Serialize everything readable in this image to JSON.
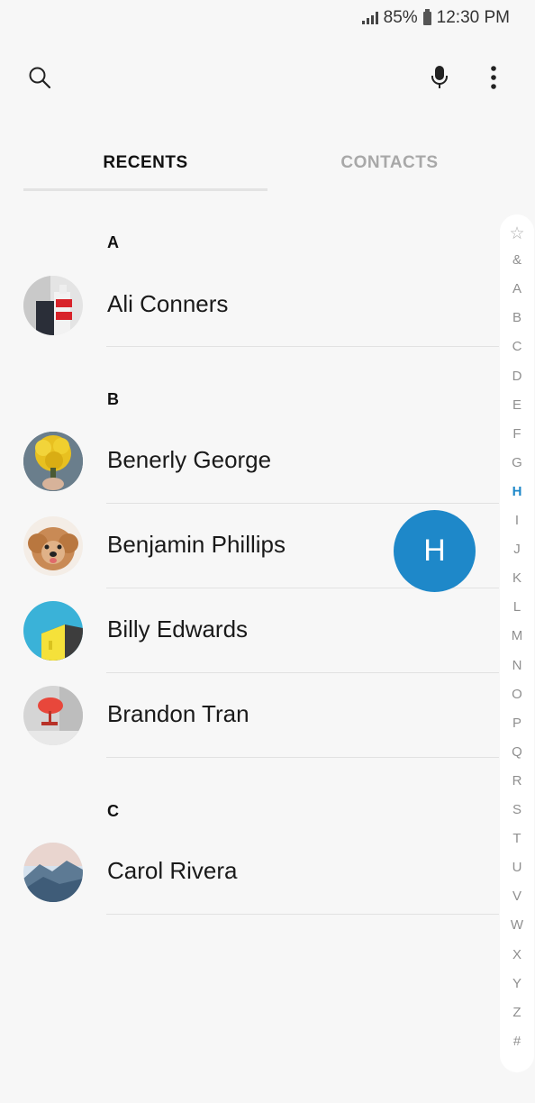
{
  "status_bar": {
    "battery_percent": "85%",
    "time": "12:30 PM"
  },
  "toolbar": {
    "search_icon": "search-icon",
    "mic_icon": "microphone-icon",
    "more_icon": "more-vertical-icon"
  },
  "tabs": [
    {
      "label": "RECENTS",
      "active": true
    },
    {
      "label": "CONTACTS",
      "active": false
    }
  ],
  "sections": [
    {
      "letter": "A",
      "contacts": [
        {
          "name": "Ali Conners"
        }
      ]
    },
    {
      "letter": "B",
      "contacts": [
        {
          "name": "Benerly George"
        },
        {
          "name": "Benjamin Phillips"
        },
        {
          "name": "Billy Edwards"
        },
        {
          "name": "Brandon Tran"
        }
      ]
    },
    {
      "letter": "C",
      "contacts": [
        {
          "name": "Carol Rivera"
        }
      ]
    }
  ],
  "fast_scroll": {
    "letters": [
      "☆",
      "&",
      "A",
      "B",
      "C",
      "D",
      "E",
      "F",
      "G",
      "H",
      "I",
      "J",
      "K",
      "L",
      "M",
      "N",
      "O",
      "P",
      "Q",
      "R",
      "S",
      "T",
      "U",
      "V",
      "W",
      "X",
      "Y",
      "Z",
      "#"
    ],
    "selected": "H"
  },
  "bubble": {
    "letter": "H"
  },
  "colors": {
    "accent": "#1e88c9",
    "background": "#f7f7f7"
  }
}
